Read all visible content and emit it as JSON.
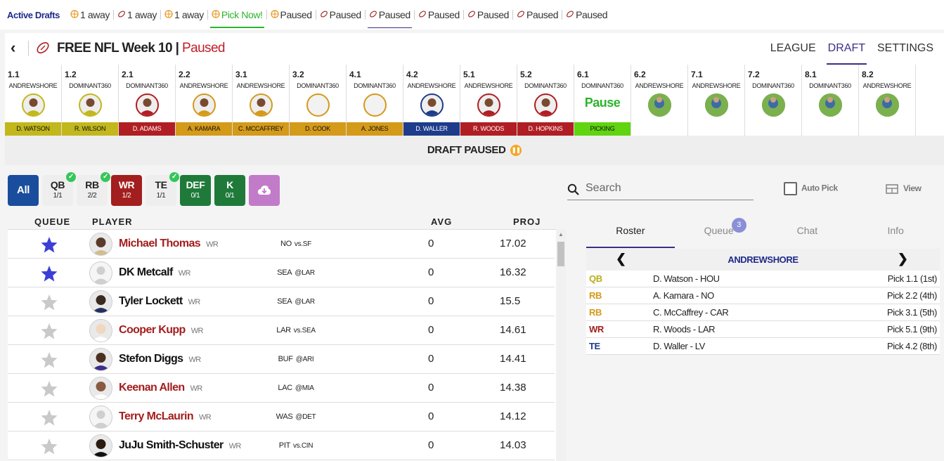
{
  "top_tabs": {
    "title": "Active Drafts",
    "tabs": [
      {
        "label": "1 away",
        "icon": "basketball-icon"
      },
      {
        "label": "1 away",
        "icon": "football-icon"
      },
      {
        "label": "1 away",
        "icon": "basketball-icon"
      },
      {
        "label": "Pick Now!",
        "icon": "basketball-icon",
        "state": "now"
      },
      {
        "label": "Paused",
        "icon": "basketball-icon"
      },
      {
        "label": "Paused",
        "icon": "football-icon"
      },
      {
        "label": "Paused",
        "icon": "football-icon",
        "state": "selected"
      },
      {
        "label": "Paused",
        "icon": "football-icon"
      },
      {
        "label": "Paused",
        "icon": "football-icon"
      },
      {
        "label": "Paused",
        "icon": "football-icon"
      },
      {
        "label": "Paused",
        "icon": "football-icon"
      }
    ]
  },
  "header": {
    "title": "FREE NFL Week 10",
    "divider": "|",
    "status": "Paused",
    "nav": [
      "LEAGUE",
      "DRAFT",
      "SETTINGS"
    ],
    "active_nav": "DRAFT"
  },
  "board": [
    {
      "num": "1.1",
      "owner": "ANDREWSHORE",
      "player": "D. WATSON",
      "color": "#c2b71c"
    },
    {
      "num": "1.2",
      "owner": "DOMINANT360",
      "player": "R. WILSON",
      "color": "#c2b71c"
    },
    {
      "num": "2.1",
      "owner": "DOMINANT360",
      "player": "D. ADAMS",
      "color": "#b01e23"
    },
    {
      "num": "2.2",
      "owner": "ANDREWSHORE",
      "player": "A. KAMARA",
      "color": "#d49a1a"
    },
    {
      "num": "3.1",
      "owner": "ANDREWSHORE",
      "player": "C. MCCAFFREY",
      "color": "#d49a1a"
    },
    {
      "num": "3.2",
      "owner": "DOMINANT360",
      "player": "D. COOK",
      "color": "#d49a1a"
    },
    {
      "num": "4.1",
      "owner": "DOMINANT360",
      "player": "A. JONES",
      "color": "#d49a1a"
    },
    {
      "num": "4.2",
      "owner": "ANDREWSHORE",
      "player": "D. WALLER",
      "color": "#1e3c8a"
    },
    {
      "num": "5.1",
      "owner": "ANDREWSHORE",
      "player": "R. WOODS",
      "color": "#b01e23"
    },
    {
      "num": "5.2",
      "owner": "DOMINANT360",
      "player": "D. HOPKINS",
      "color": "#b01e23"
    },
    {
      "num": "6.1",
      "owner": "DOMINANT360",
      "player": "PICKING",
      "color": "#5fd40f",
      "pause": "Pause"
    },
    {
      "num": "6.2",
      "owner": "ANDREWSHORE",
      "player": "",
      "color": ""
    },
    {
      "num": "7.1",
      "owner": "ANDREWSHORE",
      "player": "",
      "color": ""
    },
    {
      "num": "7.2",
      "owner": "DOMINANT360",
      "player": "",
      "color": ""
    },
    {
      "num": "8.1",
      "owner": "DOMINANT360",
      "player": "",
      "color": ""
    },
    {
      "num": "8.2",
      "owner": "ANDREWSHORE",
      "player": "",
      "color": ""
    }
  ],
  "paused_banner": "DRAFT PAUSED",
  "filters": [
    {
      "label": "All",
      "count": "",
      "bg": "#1a4d9c",
      "fg": "#ffffff",
      "check": false
    },
    {
      "label": "QB",
      "count": "1/1",
      "bg": "#eeeeee",
      "fg": "#222222",
      "check": true
    },
    {
      "label": "RB",
      "count": "2/2",
      "bg": "#eeeeee",
      "fg": "#222222",
      "check": true
    },
    {
      "label": "WR",
      "count": "1/2",
      "bg": "#a31e1e",
      "fg": "#ffffff",
      "check": false
    },
    {
      "label": "TE",
      "count": "1/1",
      "bg": "#eeeeee",
      "fg": "#222222",
      "check": true
    },
    {
      "label": "DEF",
      "count": "0/1",
      "bg": "#1f7a3a",
      "fg": "#ffffff",
      "check": false
    },
    {
      "label": "K",
      "count": "0/1",
      "bg": "#1f7a3a",
      "fg": "#ffffff",
      "check": false
    },
    {
      "label": "",
      "count": "",
      "bg": "#c27bc9",
      "fg": "#ffffff",
      "check": false,
      "icon": "cloud-download-icon"
    }
  ],
  "table": {
    "headers": {
      "queue": "QUEUE",
      "player": "PLAYER",
      "avg": "AVG",
      "proj": "PROJ"
    },
    "rows": [
      {
        "name": "Michael Thomas",
        "pos": "WR",
        "team": "NO",
        "game": "vs.SF",
        "avg": "0",
        "proj": "17.02",
        "queued": true,
        "red": true
      },
      {
        "name": "DK Metcalf",
        "pos": "WR",
        "team": "SEA",
        "game": "@LAR",
        "avg": "0",
        "proj": "16.32",
        "queued": true,
        "red": false
      },
      {
        "name": "Tyler Lockett",
        "pos": "WR",
        "team": "SEA",
        "game": "@LAR",
        "avg": "0",
        "proj": "15.5",
        "queued": false,
        "red": false
      },
      {
        "name": "Cooper Kupp",
        "pos": "WR",
        "team": "LAR",
        "game": "vs.SEA",
        "avg": "0",
        "proj": "14.61",
        "queued": false,
        "red": true
      },
      {
        "name": "Stefon Diggs",
        "pos": "WR",
        "team": "BUF",
        "game": "@ARI",
        "avg": "0",
        "proj": "14.41",
        "queued": false,
        "red": false
      },
      {
        "name": "Keenan Allen",
        "pos": "WR",
        "team": "LAC",
        "game": "@MIA",
        "avg": "0",
        "proj": "14.38",
        "queued": false,
        "red": true
      },
      {
        "name": "Terry McLaurin",
        "pos": "WR",
        "team": "WAS",
        "game": "@DET",
        "avg": "0",
        "proj": "14.12",
        "queued": false,
        "red": true
      },
      {
        "name": "JuJu Smith-Schuster",
        "pos": "WR",
        "team": "PIT",
        "game": "vs.CIN",
        "avg": "0",
        "proj": "14.03",
        "queued": false,
        "red": false
      }
    ]
  },
  "search": {
    "placeholder": "Search"
  },
  "autopick_label": "Auto Pick",
  "view_label": "View",
  "right_tabs": [
    "Roster",
    "Queue",
    "Chat",
    "Info"
  ],
  "queue_badge": "3",
  "roster": {
    "team": "ANDREWSHORE",
    "rows": [
      {
        "pos": "QB",
        "player": "D. Watson - HOU",
        "pick": "Pick 1.1 (1st)",
        "color": "#b8ae18"
      },
      {
        "pos": "RB",
        "player": "A. Kamara - NO",
        "pick": "Pick 2.2 (4th)",
        "color": "#d49a1a"
      },
      {
        "pos": "RB",
        "player": "C. McCaffrey - CAR",
        "pick": "Pick 3.1 (5th)",
        "color": "#d49a1a"
      },
      {
        "pos": "WR",
        "player": "R. Woods - LAR",
        "pick": "Pick 5.1 (9th)",
        "color": "#a31e1e"
      },
      {
        "pos": "TE",
        "player": "D. Waller - LV",
        "pick": "Pick 4.2 (8th)",
        "color": "#1e3c8a"
      }
    ]
  }
}
